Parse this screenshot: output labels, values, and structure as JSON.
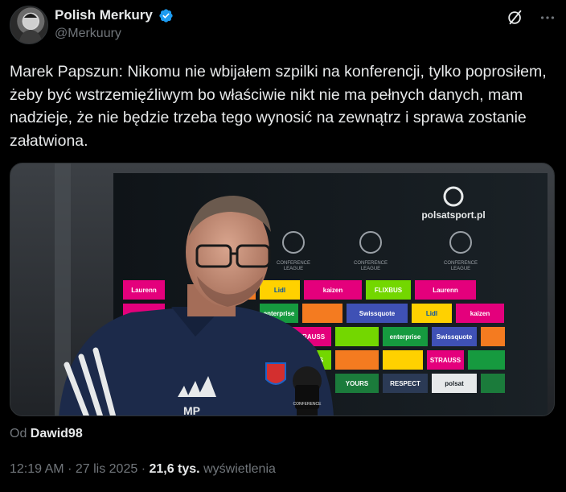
{
  "author": {
    "display_name": "Polish Merkury",
    "handle": "@Merkuury",
    "verified": true,
    "avatar_icon": "profile-avatar"
  },
  "header_actions": {
    "grok_icon": "grok-icon",
    "more_icon": "more-dots-icon"
  },
  "tweet": {
    "text": "Marek Papszun: Nikomu nie wbijałem szpilki na konferencji, tylko poprosiłem, żeby być wstrzemięźliwym bo właściwie nikt nie ma pełnych danych, mam nadzieje, że nie będzie trzeba tego wynosić na zewnątrz i sprawa zostanie załatwiona."
  },
  "media": {
    "watermark": "polsatsport.pl",
    "backdrop_logos": [
      "CONFERENCE LEAGUE",
      "Laurenn",
      "kaizen foundation",
      "FLIXBUS",
      "Lidl",
      "enterprise RENT-A-CAR",
      "Swissquote",
      "STRAUSS",
      "MAKE IT YOURS",
      "RESPECT",
      "polsat sport"
    ],
    "jacket_initials": "MP"
  },
  "attribution": {
    "prefix": "Od",
    "name": "Dawid98"
  },
  "meta": {
    "time": "12:19 AM",
    "separator": "·",
    "date": "27 lis 2025",
    "views_count": "21,6 tys.",
    "views_label": "wyświetlenia"
  },
  "colors": {
    "background": "#000000",
    "text": "#e7e9ea",
    "secondary": "#71767b",
    "verified_blue": "#1d9bf0"
  }
}
